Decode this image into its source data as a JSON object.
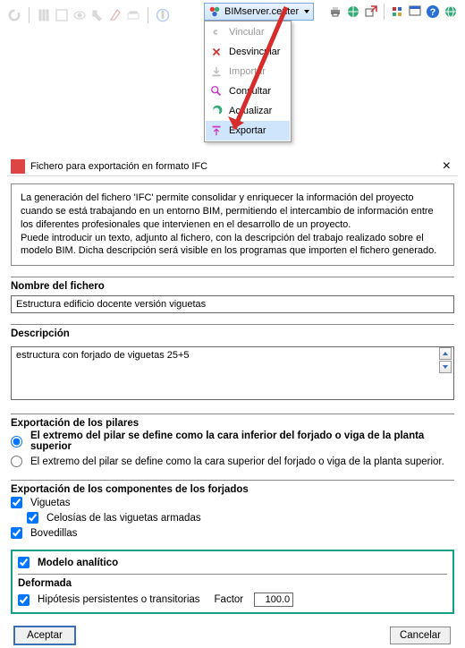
{
  "toolbar": {
    "bim_button": "BIMserver.center"
  },
  "dropdown": {
    "items": [
      {
        "label": "Vincular",
        "disabled": true,
        "icon": "link-icon"
      },
      {
        "label": "Desvincular",
        "disabled": false,
        "icon": "unlink-icon"
      },
      {
        "label": "Importar",
        "disabled": true,
        "icon": "import-icon"
      },
      {
        "label": "Consultar",
        "disabled": false,
        "icon": "query-icon"
      },
      {
        "label": "Actualizar",
        "disabled": false,
        "icon": "refresh-icon"
      },
      {
        "label": "Exportar",
        "disabled": false,
        "icon": "export-icon",
        "highlight": true
      }
    ]
  },
  "dialog": {
    "title": "Fichero para exportación en formato IFC",
    "info": "La generación del fichero 'IFC' permite consolidar y enriquecer la información del proyecto cuando se está trabajando en un entorno BIM, permitiendo el intercambio de información entre los diferentes profesionales que intervienen en el desarrollo de un proyecto.\nPuede introducir un texto, adjunto al fichero, con la descripción del trabajo realizado sobre el modelo BIM. Dicha descripción será visible en los programas que importen el fichero generado.",
    "nombre_label": "Nombre del fichero",
    "nombre_value": "Estructura edificio docente versión viguetas",
    "descripcion_label": "Descripción",
    "descripcion_value": "estructura con forjado de viguetas 25+5",
    "pilares_label": "Exportación de los pilares",
    "radios": {
      "r1": "El extremo del pilar se define como la cara inferior del forjado o viga de la planta superior",
      "r2": "El extremo del pilar se define como la cara superior del forjado o viga de la planta superior.",
      "selected": "r1"
    },
    "componentes_label": "Exportación de los componentes de los forjados",
    "checks": {
      "viguetas": {
        "label": "Viguetas",
        "checked": true
      },
      "celosias": {
        "label": "Celosías de las viguetas armadas",
        "checked": true
      },
      "bovedillas": {
        "label": "Bovedillas",
        "checked": true
      }
    },
    "modelo_label": "Modelo analítico",
    "modelo_checked": true,
    "deformada_label": "Deformada",
    "hipotesis": {
      "label": "Hipótesis persistentes o transitorias",
      "checked": true,
      "factor_label": "Factor",
      "factor_value": "100.0"
    },
    "aceptar": "Aceptar",
    "cancelar": "Cancelar"
  }
}
